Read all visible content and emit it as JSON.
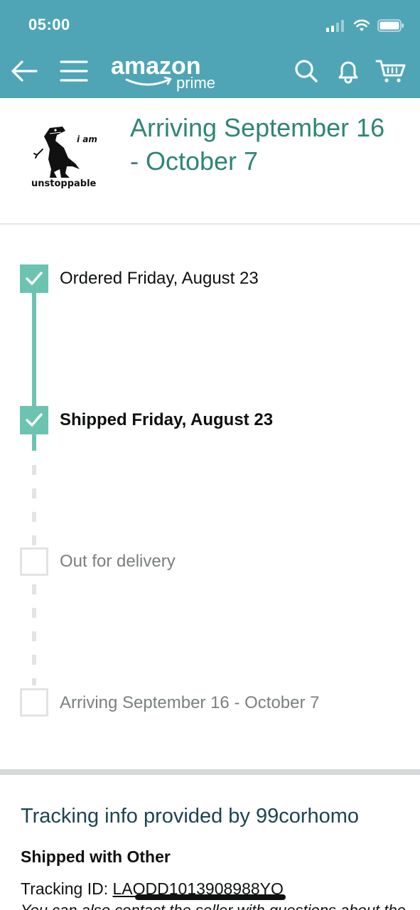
{
  "status_bar": {
    "time": "05:00"
  },
  "header": {
    "logo_word": "amazon",
    "logo_sub": "prime",
    "brand_color": "#4fa5b5",
    "icons": [
      "back-arrow-icon",
      "menu-icon",
      "search-icon",
      "bell-icon",
      "cart-icon"
    ]
  },
  "product": {
    "image_text_top": "i am",
    "image_text_bottom": "unstoppable",
    "arriving_title": "Arriving September 16 - October 7"
  },
  "timeline": {
    "accent_color": "#6cc4b0",
    "steps": [
      {
        "label": "Ordered Friday, August 23",
        "done": true
      },
      {
        "label": "Shipped Friday, August 23",
        "done": true,
        "current": true
      },
      {
        "label": "Out for delivery",
        "done": false
      },
      {
        "label": "Arriving September 16 - October 7",
        "done": false
      }
    ]
  },
  "tracking": {
    "heading": "Tracking info provided by 99corhomo",
    "shipped_with": "Shipped with Other",
    "tracking_id_label": "Tracking ID: ",
    "tracking_id": "LAODD1013908988YQ",
    "contact_text": "You can also contact the seller with questions about the"
  }
}
